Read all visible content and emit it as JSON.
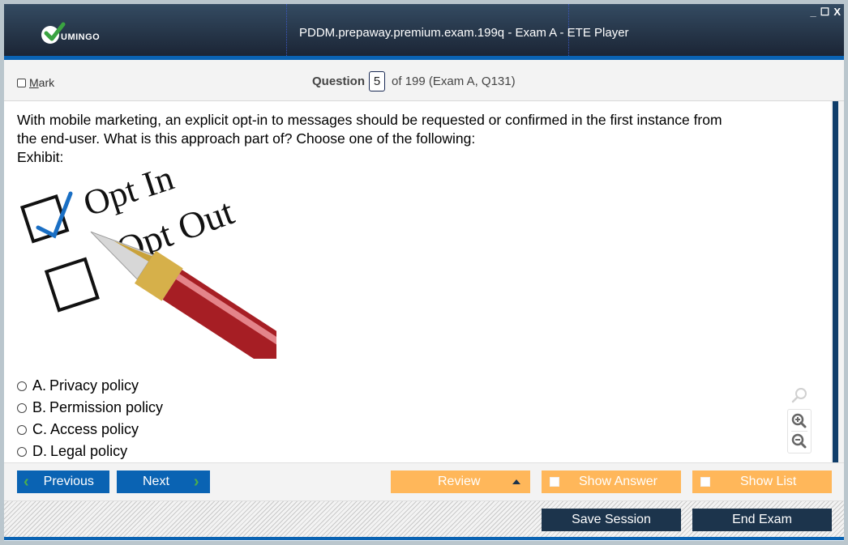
{
  "window": {
    "title": "PDDM.prepaway.premium.exam.199q - Exam A - ETE Player",
    "logo_text": "UMINGO",
    "controls": {
      "minimize": "_",
      "maximize": "☐",
      "close": "X"
    }
  },
  "header": {
    "mark_label_first": "M",
    "mark_label_rest": "ark",
    "mark_checked": false,
    "question_label": "Question",
    "question_number": "5",
    "question_suffix": "of 199 (Exam A, Q131)"
  },
  "question": {
    "line1": "With mobile marketing, an explicit opt-in to messages should be requested or confirmed in the first instance from",
    "line2": "the end-user. What is this approach part of? Choose one of the following:",
    "line3": "Exhibit:",
    "exhibit": {
      "opt_in": "Opt In",
      "opt_out": "Opt Out",
      "description": "Checkbox with Opt In checked and Opt Out unchecked, fountain pen"
    }
  },
  "answers": [
    {
      "letter": "A.",
      "text": "Privacy policy",
      "selected": false
    },
    {
      "letter": "B.",
      "text": "Permission policy",
      "selected": false
    },
    {
      "letter": "C.",
      "text": "Access policy",
      "selected": false
    },
    {
      "letter": "D.",
      "text": "Legal policy",
      "selected": false
    }
  ],
  "zoom_tools": {
    "icons": [
      "search-icon",
      "zoom-in-icon",
      "zoom-out-icon"
    ]
  },
  "nav": {
    "previous": "Previous",
    "next": "Next",
    "review": "Review",
    "show_answer": "Show Answer",
    "show_list": "Show List"
  },
  "bottom": {
    "save_session": "Save Session",
    "end_exam": "End Exam"
  },
  "colors": {
    "title_bar": "#1b2535",
    "accent_blue": "#0a63b3",
    "orange": "#ffb75a",
    "dark_button": "#1c344c",
    "chevron_green": "#4cae4c"
  }
}
